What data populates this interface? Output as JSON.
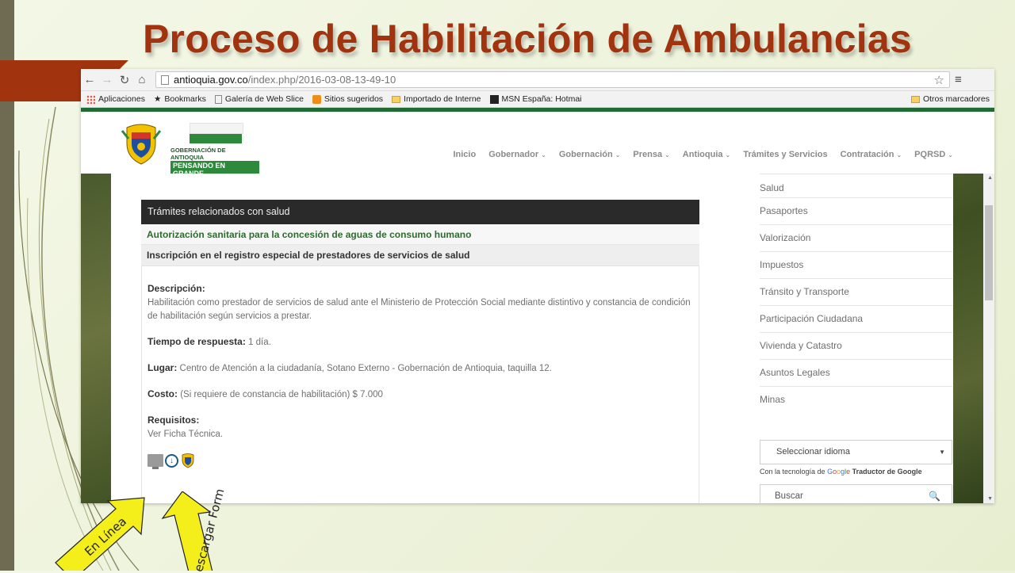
{
  "slide": {
    "title": "Proceso de Habilitación de Ambulancias",
    "colors": {
      "title": "#a2330f",
      "accent_tab": "#a2330f",
      "strip": "#6f6a52"
    },
    "arrow_labels": {
      "online": "En Línea",
      "download": "escargar Form"
    }
  },
  "browser": {
    "url_host": "antioquia.gov.co",
    "url_path": "/index.php/2016-03-08-13-49-10",
    "bookmarks": [
      {
        "label": "Aplicaciones",
        "icon": "apps-grid-icon"
      },
      {
        "label": "Bookmarks",
        "icon": "star-icon"
      },
      {
        "label": "Galería de Web Slice",
        "icon": "page-icon"
      },
      {
        "label": "Sitios sugeridos",
        "icon": "orange-square-icon"
      },
      {
        "label": "Importado de Interne",
        "icon": "folder-icon"
      },
      {
        "label": "MSN España: Hotmai",
        "icon": "msn-icon"
      }
    ],
    "other_bookmarks": "Otros marcadores"
  },
  "site": {
    "logo_small": "GOBERNACIÓN DE ANTIOQUIA",
    "logo_slogan": "PENSANDO EN GRANDE",
    "nav": [
      {
        "label": "Inicio",
        "dropdown": false
      },
      {
        "label": "Gobernador",
        "dropdown": true
      },
      {
        "label": "Gobernación",
        "dropdown": true
      },
      {
        "label": "Prensa",
        "dropdown": true
      },
      {
        "label": "Antioquia",
        "dropdown": true
      },
      {
        "label": "Trámites y Servicios",
        "dropdown": false
      },
      {
        "label": "Contratación",
        "dropdown": true
      },
      {
        "label": "PQRSD",
        "dropdown": true
      }
    ]
  },
  "main": {
    "panel_title": "Trámites relacionados con salud",
    "item_1": "Autorización sanitaria para la concesión de aguas de consumo humano",
    "item_2": "Inscripción en el registro especial de prestadores de servicios de salud",
    "descripcion_label": "Descripción:",
    "descripcion_text": "Habilitación como prestador de servicios de salud ante el Ministerio de Protección Social mediante distintivo y constancia de condición de habilitación según servicios a prestar.",
    "tiempo_label": "Tiempo de respuesta:",
    "tiempo_value": "1 día.",
    "lugar_label": "Lugar:",
    "lugar_value": "Centro de Atención a la ciudadanía, Sotano Externo - Gobernación de Antioquia, taquilla 12.",
    "costo_label": "Costo:",
    "costo_value": "(Si requiere de constancia de habilitación)  $ 7.000",
    "requisitos_label": "Requisitos:",
    "requisitos_value": "Ver Ficha Técnica."
  },
  "sidebar": {
    "items": [
      "Salud",
      "Pasaportes",
      "Valorización",
      "Impuestos",
      "Tránsito y Transporte",
      "Participación Ciudadana",
      "Vivienda y Catastro",
      "Asuntos Legales",
      "Minas"
    ],
    "language_select": "Seleccionar idioma",
    "powered_prefix": "Con la tecnología de",
    "google_word": "Google",
    "powered_suffix": "Traductor de Google",
    "search_placeholder": "Buscar"
  }
}
